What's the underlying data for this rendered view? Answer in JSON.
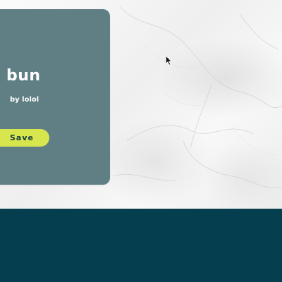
{
  "card": {
    "title": "bun",
    "author": "by lolol",
    "save_label": "Save"
  },
  "colors": {
    "card_background": "#607f84",
    "save_button": "#d8e64e",
    "footer": "#053f4f",
    "text_light": "#ffffff",
    "text_dark": "#123b43"
  },
  "icons": {
    "cursor": "mouse-pointer-icon"
  }
}
